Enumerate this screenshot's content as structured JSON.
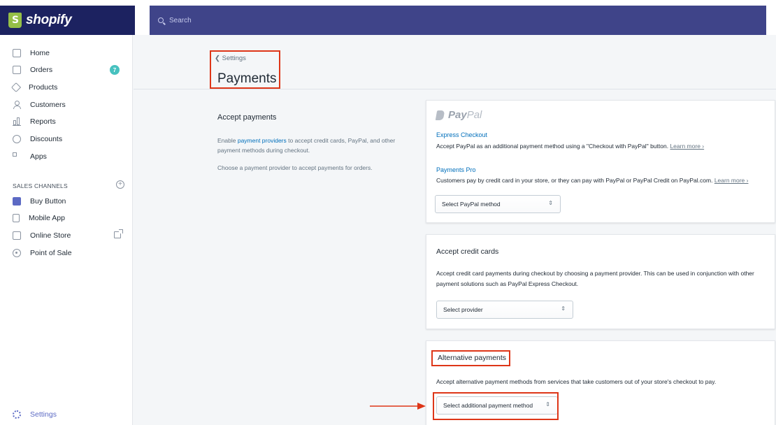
{
  "topbar": {
    "brand_name": "shopify",
    "search_placeholder": "Search"
  },
  "sidebar": {
    "items": [
      {
        "label": "Home",
        "icon": "home-icon"
      },
      {
        "label": "Orders",
        "icon": "orders-icon",
        "badge": "7"
      },
      {
        "label": "Products",
        "icon": "tag-icon"
      },
      {
        "label": "Customers",
        "icon": "person-icon"
      },
      {
        "label": "Reports",
        "icon": "bar-chart-icon"
      },
      {
        "label": "Discounts",
        "icon": "discount-icon"
      },
      {
        "label": "Apps",
        "icon": "apps-icon"
      }
    ],
    "channels_label": "SALES CHANNELS",
    "channels": [
      {
        "label": "Buy Button",
        "icon": "code-icon"
      },
      {
        "label": "Mobile App",
        "icon": "mobile-icon"
      },
      {
        "label": "Online Store",
        "icon": "store-icon"
      },
      {
        "label": "Point of Sale",
        "icon": "location-pin-icon"
      }
    ],
    "settings_label": "Settings"
  },
  "header": {
    "breadcrumb": "Settings",
    "title": "Payments"
  },
  "accept": {
    "title": "Accept payments",
    "p1_prefix": "Enable ",
    "p1_link": "payment providers",
    "p1_suffix": " to accept credit cards, PayPal, and other payment methods during checkout.",
    "p2": "Choose a payment provider to accept payments for orders."
  },
  "paypal": {
    "logo_bold": "Pay",
    "logo_light": "Pal",
    "express_title": "Express Checkout",
    "express_text": "Accept PayPal as an additional payment method using a \"Checkout with PayPal\" button.",
    "learn_more": "Learn more ›",
    "pro_title": "Payments Pro",
    "pro_text": "Customers pay by credit card in your store, or they can pay with PayPal or PayPal Credit on PayPal.com.",
    "select_label": "Select PayPal method"
  },
  "credit": {
    "title": "Accept credit cards",
    "text": "Accept credit card payments during checkout by choosing a payment provider. This can be used in conjunction with other payment solutions such as PayPal Express Checkout.",
    "select_label": "Select provider"
  },
  "alternative": {
    "title": "Alternative payments",
    "text": "Accept alternative payment methods from services that take customers out of your store's checkout to pay.",
    "select_label": "Select additional payment method"
  },
  "colors": {
    "brand_navy": "#1c2260",
    "search_bg": "#3f4489",
    "highlight_red": "#de3618",
    "link_blue": "#006fbb",
    "badge_teal": "#47c1bf"
  }
}
